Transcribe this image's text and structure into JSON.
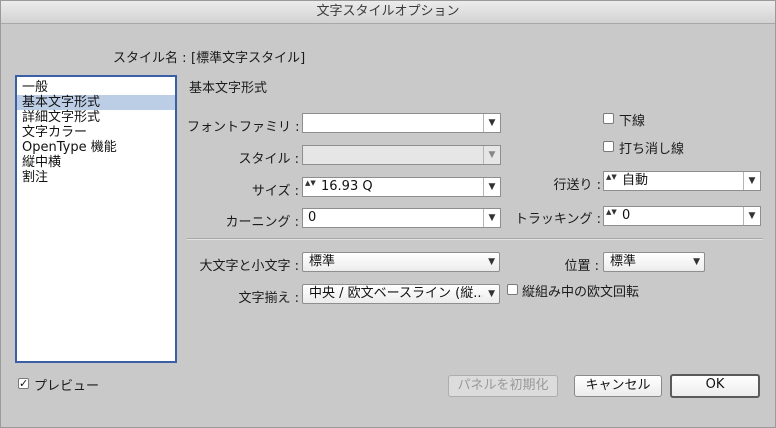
{
  "window": {
    "title": "文字スタイルオプション"
  },
  "style_name": {
    "label": "スタイル名 :",
    "value": "[標準文字スタイル]"
  },
  "categories": [
    "一般",
    "基本文字形式",
    "詳細文字形式",
    "文字カラー",
    "OpenType 機能",
    "縦中横",
    "割注"
  ],
  "section_title": "基本文字形式",
  "font_family": {
    "label": "フォントファミリ :",
    "value": ""
  },
  "style": {
    "label": "スタイル :",
    "value": ""
  },
  "size": {
    "label": "サイズ :",
    "value": "16.93 Q"
  },
  "kerning": {
    "label": "カーニング :",
    "value": "0"
  },
  "underline": {
    "label": "下線",
    "checked": false
  },
  "strikethrough": {
    "label": "打ち消し線",
    "checked": false
  },
  "leading": {
    "label": "行送り :",
    "value": "自動"
  },
  "tracking": {
    "label": "トラッキング :",
    "value": "0"
  },
  "case": {
    "label": "大文字と小文字 :",
    "value": "標準"
  },
  "position": {
    "label": "位置 :",
    "value": "標準"
  },
  "alignment": {
    "label": "文字揃え :",
    "value": "中央 / 欧文ベースライン (縦..."
  },
  "tate_chu_yoko": {
    "label": "縦組み中の欧文回転",
    "checked": false
  },
  "preview": {
    "label": "プレビュー",
    "checked": true
  },
  "buttons": {
    "reset": "パネルを初期化",
    "cancel": "キャンセル",
    "ok": "OK"
  },
  "icons": {
    "dropdown": "▼",
    "spinner": "▲▼",
    "check": "✓"
  }
}
